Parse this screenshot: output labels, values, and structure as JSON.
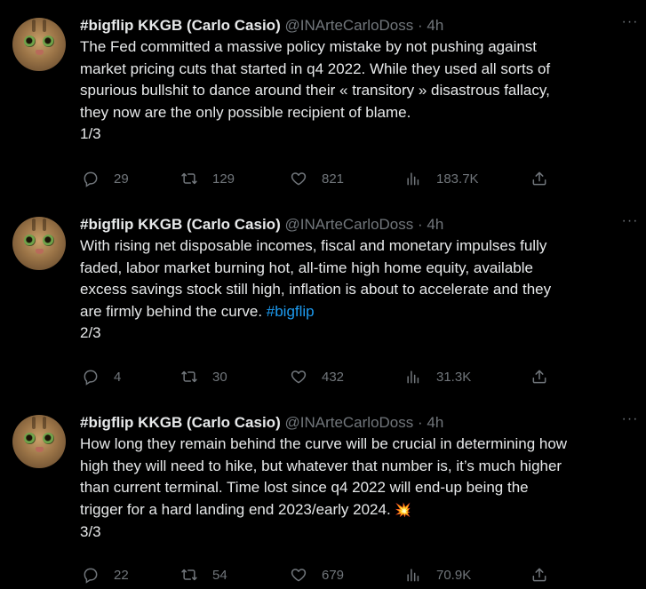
{
  "colors": {
    "background": "#000000",
    "text": "#e7e9ea",
    "muted": "#71767b",
    "link": "#1d9bf0"
  },
  "tweets": [
    {
      "name": "#bigflip KKGB (Carlo Casio)",
      "handle": "@INArteCarloDoss",
      "time": "· 4h",
      "more": "···",
      "lines": [
        "The Fed committed a massive policy mistake by not pushing against",
        "market pricing cuts that started in q4 2022. While they used all sorts of",
        "spurious bullshit to dance around their « transitory » disastrous fallacy,",
        "they now are the only possible recipient of blame."
      ],
      "counter": "1/3",
      "replies": "29",
      "retweets": "129",
      "likes": "821",
      "views": "183.7K"
    },
    {
      "name": "#bigflip KKGB (Carlo Casio)",
      "handle": "@INArteCarloDoss",
      "time": "· 4h",
      "more": "···",
      "lines": [
        "With rising net disposable incomes, fiscal and monetary impulses fully",
        "faded, labor market burning hot, all-time high home equity, available",
        "excess savings stock still high, inflation is about to accelerate and they"
      ],
      "last_line_text": "are firmly behind the curve. ",
      "hashtag": "#bigflip",
      "counter": "2/3",
      "replies": "4",
      "retweets": "30",
      "likes": "432",
      "views": "31.3K"
    },
    {
      "name": "#bigflip KKGB (Carlo Casio)",
      "handle": "@INArteCarloDoss",
      "time": "· 4h",
      "more": "···",
      "lines": [
        "How long they remain behind the curve will be crucial in determining how",
        "high they will need to hike, but whatever that number is, it’s much higher",
        "than current terminal. Time lost since q4 2022 will end-up being the"
      ],
      "last_line_text": "trigger for a hard landing end 2023/early 2024. ",
      "emoji": "💥",
      "counter": "3/3",
      "replies": "22",
      "retweets": "54",
      "likes": "679",
      "views": "70.9K"
    }
  ]
}
